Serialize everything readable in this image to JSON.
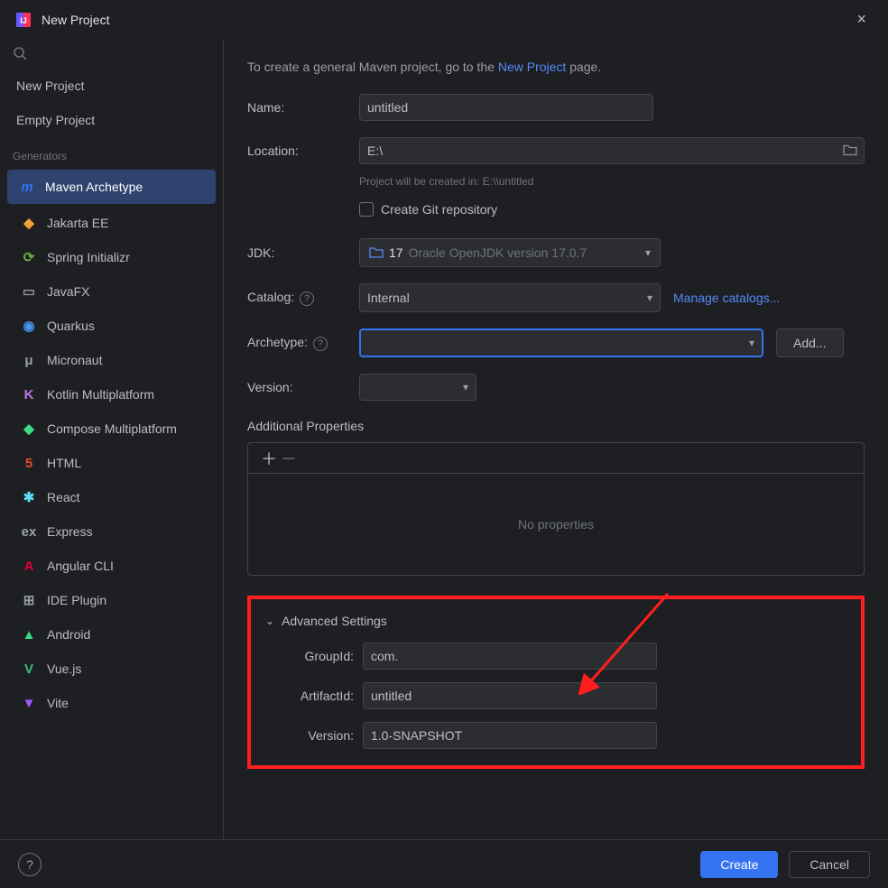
{
  "window": {
    "title": "New Project",
    "close": "×"
  },
  "sidebar": {
    "topItems": [
      {
        "label": "New Project"
      },
      {
        "label": "Empty Project"
      }
    ],
    "generatorsLabel": "Generators",
    "generators": [
      {
        "label": "Maven Archetype",
        "iconColor": "#3574f0",
        "glyph": "m",
        "selected": true
      },
      {
        "label": "Jakarta EE",
        "iconColor": "#f0a33c",
        "glyph": "◆"
      },
      {
        "label": "Spring Initializr",
        "iconColor": "#6db33f",
        "glyph": "⟳"
      },
      {
        "label": "JavaFX",
        "iconColor": "#8e9096",
        "glyph": "▭"
      },
      {
        "label": "Quarkus",
        "iconColor": "#4695eb",
        "glyph": "◉"
      },
      {
        "label": "Micronaut",
        "iconColor": "#9aa0a6",
        "glyph": "μ"
      },
      {
        "label": "Kotlin Multiplatform",
        "iconColor": "#b778e8",
        "glyph": "K"
      },
      {
        "label": "Compose Multiplatform",
        "iconColor": "#3ddc84",
        "glyph": "◆"
      },
      {
        "label": "HTML",
        "iconColor": "#e44d26",
        "glyph": "5"
      },
      {
        "label": "React",
        "iconColor": "#61dafb",
        "glyph": "✱"
      },
      {
        "label": "Express",
        "iconColor": "#9aa0a6",
        "glyph": "ex"
      },
      {
        "label": "Angular CLI",
        "iconColor": "#dd0031",
        "glyph": "A"
      },
      {
        "label": "IDE Plugin",
        "iconColor": "#9aa0a6",
        "glyph": "⊞"
      },
      {
        "label": "Android",
        "iconColor": "#3ddc84",
        "glyph": "▲"
      },
      {
        "label": "Vue.js",
        "iconColor": "#41b883",
        "glyph": "V"
      },
      {
        "label": "Vite",
        "iconColor": "#a258ff",
        "glyph": "▼"
      }
    ]
  },
  "main": {
    "introPrefix": "To create a general Maven project, go to the ",
    "introLink": "New Project",
    "introSuffix": " page.",
    "nameLabel": "Name:",
    "nameValue": "untitled",
    "locationLabel": "Location:",
    "locationValue": "E:\\",
    "locationHint": "Project will be created in: E:\\\\untitled",
    "gitLabel": "Create Git repository",
    "jdkLabel": "JDK:",
    "jdkVersion": "17",
    "jdkDesc": "Oracle OpenJDK version 17.0.7",
    "catalogLabel": "Catalog:",
    "catalogValue": "Internal",
    "catalogManage": "Manage catalogs...",
    "archetypeLabel": "Archetype:",
    "archetypeValue": "",
    "addLabel": "Add...",
    "versionLabel": "Version:",
    "versionValue": "",
    "propsHeader": "Additional Properties",
    "noProps": "No properties",
    "advHeader": "Advanced Settings",
    "groupIdLabel": "GroupId:",
    "groupIdValue": "com.",
    "artifactIdLabel": "ArtifactId:",
    "artifactIdValue": "untitled",
    "advVersionLabel": "Version:",
    "advVersionValue": "1.0-SNAPSHOT"
  },
  "footer": {
    "create": "Create",
    "cancel": "Cancel"
  }
}
